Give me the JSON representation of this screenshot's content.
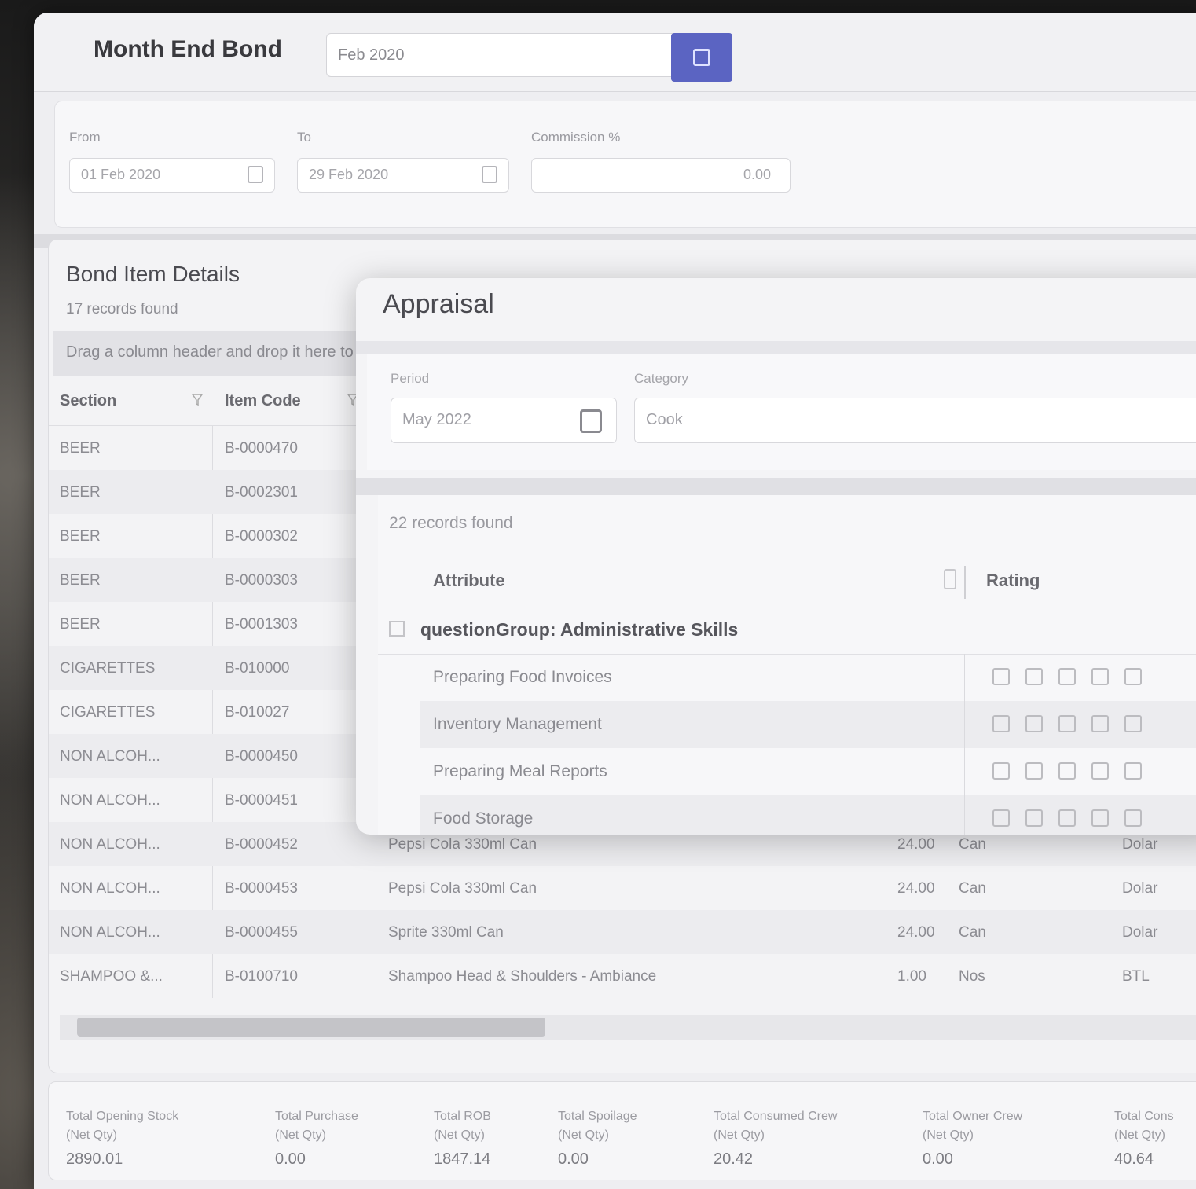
{
  "window": {
    "title": "Month End Bond",
    "period_value": "Feb 2020"
  },
  "filters": [
    {
      "label": "From",
      "value": "01 Feb 2020"
    },
    {
      "label": "To",
      "value": "29 Feb 2020"
    },
    {
      "label": "Commission %",
      "value": "0.00"
    }
  ],
  "bond_items": {
    "title": "Bond Item Details",
    "records": "17 records found",
    "group_hint": "Drag a column header and drop it here to group by that column",
    "columns": [
      "Section",
      "Item Code"
    ],
    "rows": [
      {
        "section": "BEER",
        "code": "B-0000470",
        "desc": "",
        "qty": "",
        "unit": "",
        "type": ""
      },
      {
        "section": "BEER",
        "code": "B-0002301",
        "desc": "",
        "qty": "",
        "unit": "",
        "type": ""
      },
      {
        "section": "BEER",
        "code": "B-0000302",
        "desc": "",
        "qty": "",
        "unit": "",
        "type": ""
      },
      {
        "section": "BEER",
        "code": "B-0000303",
        "desc": "",
        "qty": "",
        "unit": "",
        "type": ""
      },
      {
        "section": "BEER",
        "code": "B-0001303",
        "desc": "",
        "qty": "",
        "unit": "",
        "type": ""
      },
      {
        "section": "CIGARETTES",
        "code": "B-010000",
        "desc": "",
        "qty": "",
        "unit": "",
        "type": ""
      },
      {
        "section": "CIGARETTES",
        "code": "B-010027",
        "desc": "",
        "qty": "",
        "unit": "",
        "type": ""
      },
      {
        "section": "NON ALCOH...",
        "code": "B-0000450",
        "desc": "",
        "qty": "",
        "unit": "",
        "type": ""
      },
      {
        "section": "NON ALCOH...",
        "code": "B-0000451",
        "desc": "",
        "qty": "",
        "unit": "",
        "type": ""
      },
      {
        "section": "NON ALCOH...",
        "code": "B-0000452",
        "desc": "Pepsi Cola 330ml Can",
        "qty": "24.00",
        "unit": "Can",
        "type": "Dolar"
      },
      {
        "section": "NON ALCOH...",
        "code": "B-0000453",
        "desc": "Pepsi Cola 330ml Can",
        "qty": "24.00",
        "unit": "Can",
        "type": "Dolar"
      },
      {
        "section": "NON ALCOH...",
        "code": "B-0000455",
        "desc": "Sprite 330ml Can",
        "qty": "24.00",
        "unit": "Can",
        "type": "Dolar"
      },
      {
        "section": "SHAMPOO &...",
        "code": "B-0100710",
        "desc": "Shampoo Head & Shoulders - Ambiance",
        "qty": "1.00",
        "unit": "Nos",
        "type": "BTL"
      }
    ]
  },
  "summary": [
    {
      "label": "Total Opening Stock",
      "sub": "(Net Qty)",
      "value": "2890.01"
    },
    {
      "label": "Total Purchase",
      "sub": "(Net Qty)",
      "value": "0.00"
    },
    {
      "label": "Total ROB",
      "sub": "(Net Qty)",
      "value": "1847.14"
    },
    {
      "label": "Total Spoilage",
      "sub": "(Net Qty)",
      "value": "0.00"
    },
    {
      "label": "Total Consumed Crew",
      "sub": "(Net Qty)",
      "value": "20.42"
    },
    {
      "label": "Total Owner Crew",
      "sub": "(Net Qty)",
      "value": "0.00"
    },
    {
      "label": "Total Cons",
      "sub": "(Net Qty)",
      "value": "40.64"
    }
  ],
  "appraisal": {
    "title": "Appraisal",
    "period_label": "Period",
    "period_value": "May 2022",
    "category_label": "Category",
    "category_value": "Cook",
    "records": "22 records found",
    "col_attribute": "Attribute",
    "col_rating": "Rating",
    "group": "questionGroup: Administrative Skills",
    "items": [
      "Preparing Food Invoices",
      "Inventory Management",
      "Preparing Meal Reports",
      "Food Storage"
    ]
  }
}
